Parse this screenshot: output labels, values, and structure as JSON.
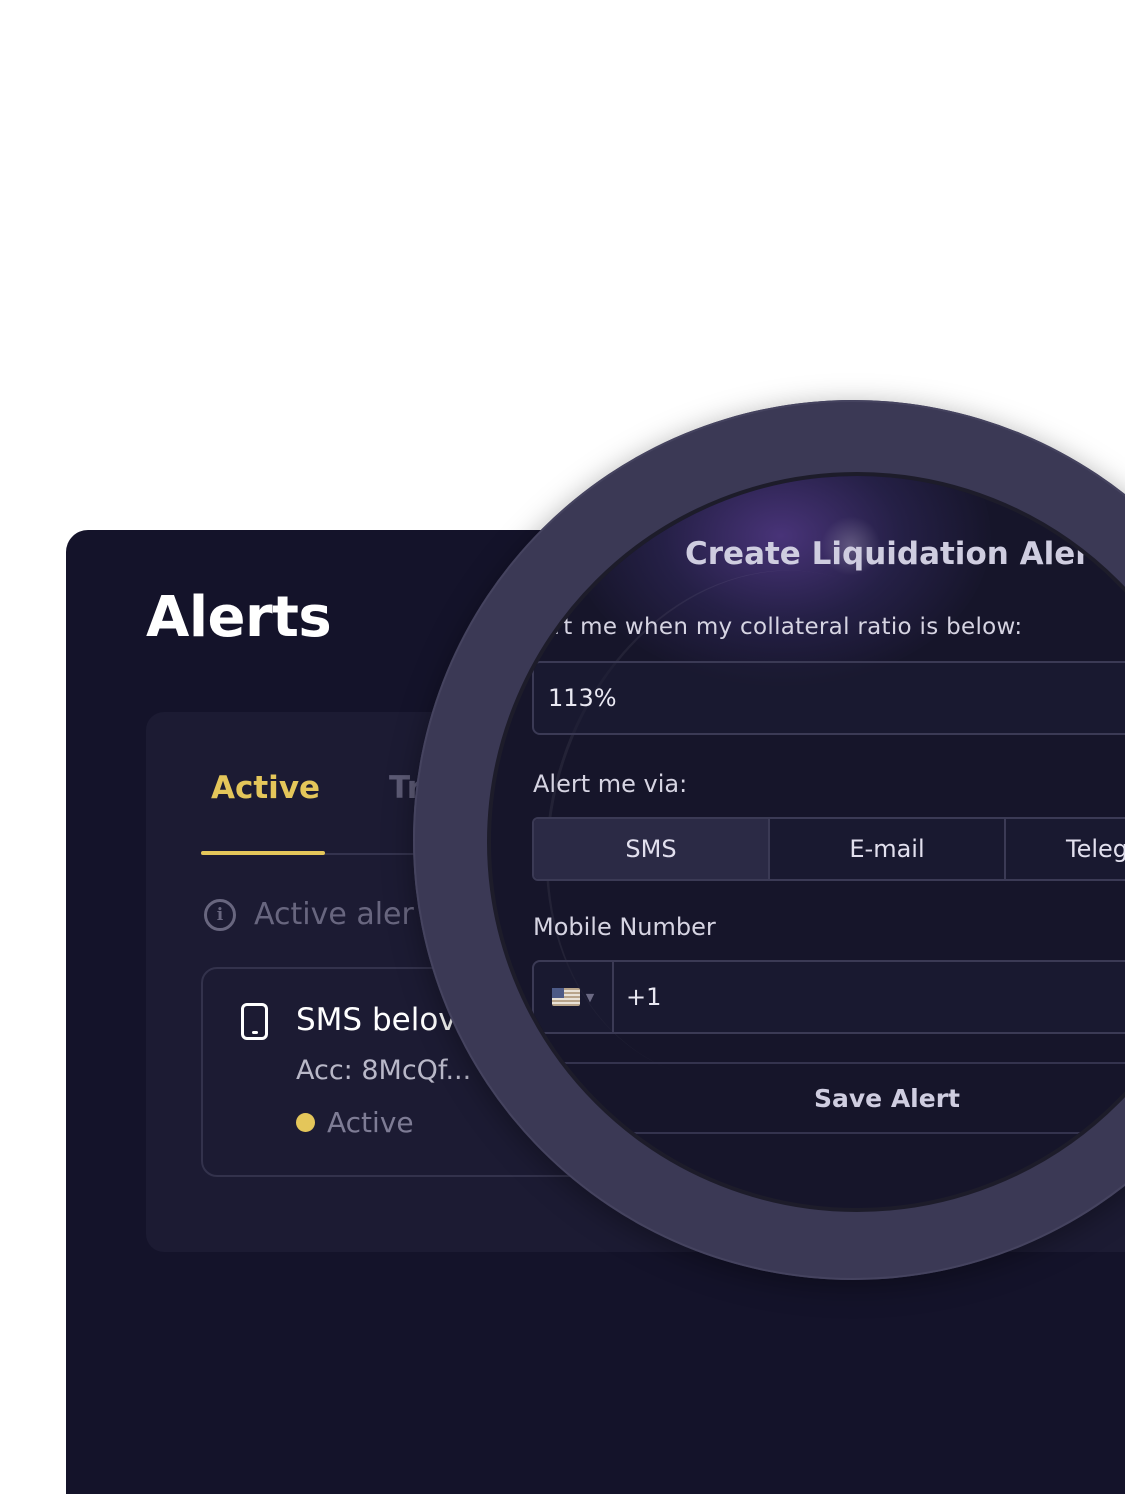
{
  "page": {
    "title": "Alerts"
  },
  "tabs": [
    {
      "label": "Active",
      "active": true
    },
    {
      "label": "Tr",
      "active": false
    }
  ],
  "info": {
    "text": "Active aler"
  },
  "alert_item": {
    "title": "SMS belov",
    "account": "Acc: 8McQf...",
    "status": "Active"
  },
  "modal": {
    "title": "Create Liquidation Alert",
    "ratio_label": "ert me when my collateral ratio is below:",
    "ratio_value": "113%",
    "via_label": "Alert me via:",
    "channels": [
      {
        "label": "SMS",
        "selected": true
      },
      {
        "label": "E-mail",
        "selected": false
      },
      {
        "label": "Teleg",
        "selected": false
      }
    ],
    "mobile_label": "Mobile Number",
    "dial_code": "+1",
    "save_label": "Save Alert"
  },
  "icons": {
    "info": "info-icon",
    "phone": "phone-icon",
    "flag": "us-flag-icon",
    "caret": "chevron-down-icon"
  },
  "colors": {
    "accent": "#e4c65a",
    "panel": "#14132a",
    "card": "#1c1b33",
    "lens_ring": "#3b3955"
  }
}
